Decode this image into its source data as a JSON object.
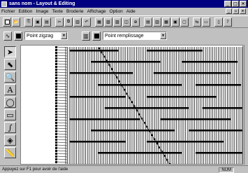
{
  "window": {
    "title": "sans nom - Layout & Editing"
  },
  "menu": [
    "Fichier",
    "Edition",
    "Image",
    "Texte",
    "Broderie",
    "Affichage",
    "Option",
    "Aide"
  ],
  "combos": {
    "stitch_type": "Point zigzag",
    "fill_type": "Point remplissage"
  },
  "status": {
    "text": "Appuyez sur F1 pour avoir de l'aide",
    "mode": "NUM"
  },
  "left_tools": [
    "select-arrow-icon",
    "node-edit-icon",
    "zoom-icon",
    "text-A-icon",
    "lasso-icon",
    "rectangle-icon",
    "freehand-curve-icon",
    "paint-bucket-icon",
    "ruler-icon"
  ]
}
